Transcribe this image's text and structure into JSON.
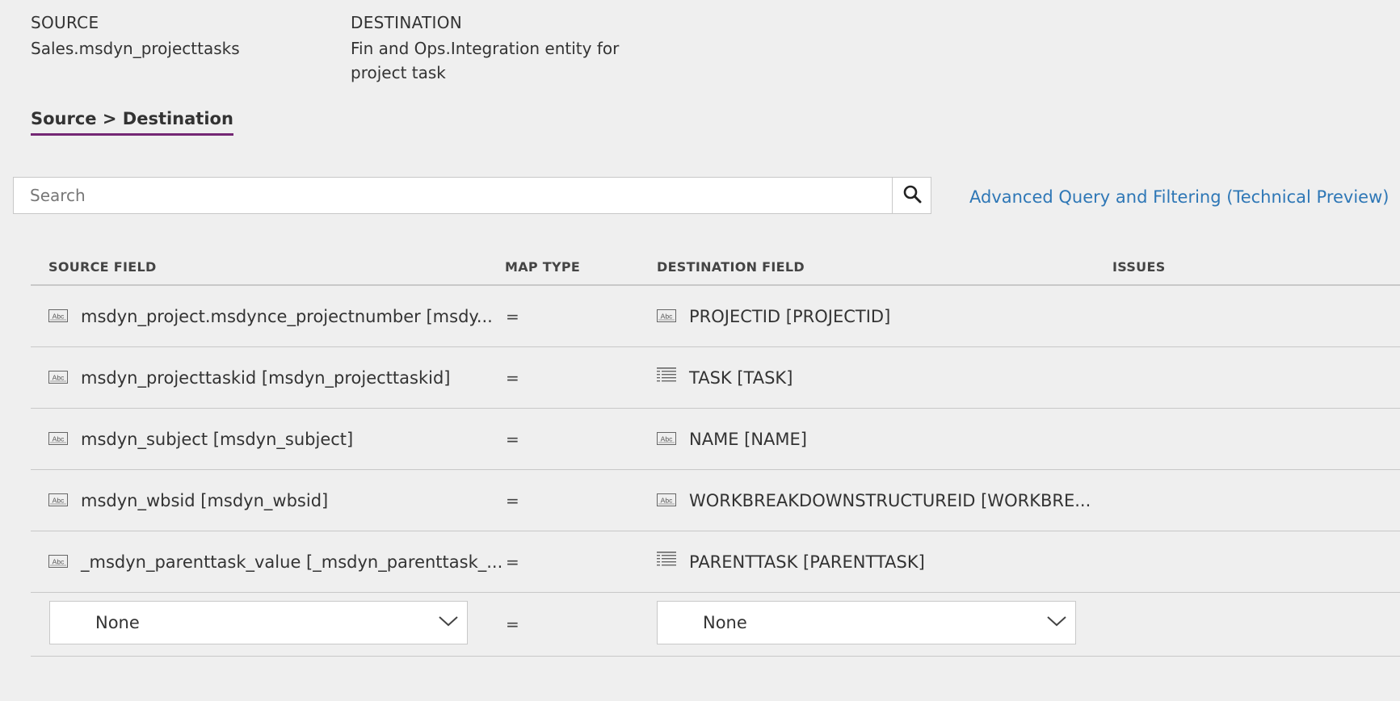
{
  "header": {
    "source_label": "SOURCE",
    "source_value": "Sales.msdyn_projecttasks",
    "destination_label": "DESTINATION",
    "destination_value_line1": "Fin and Ops.Integration entity for",
    "destination_value_line2": "project task"
  },
  "tab": {
    "label": "Source > Destination",
    "accent": "#742774"
  },
  "search": {
    "placeholder": "Search",
    "value": ""
  },
  "advanced_link": {
    "label": "Advanced Query and Filtering (Technical Preview)",
    "color": "#2e77b6"
  },
  "columns": {
    "source": "SOURCE FIELD",
    "map_type": "MAP TYPE",
    "destination": "DESTINATION FIELD",
    "issues": "ISSUES"
  },
  "rows": [
    {
      "source": "msdyn_project.msdynce_projectnumber [msdy...",
      "source_icon": "text-field-icon",
      "map": "=",
      "destination": "PROJECTID [PROJECTID]",
      "destination_icon": "text-field-icon"
    },
    {
      "source": "msdyn_projecttaskid [msdyn_projecttaskid]",
      "source_icon": "text-field-icon",
      "map": "=",
      "destination": "TASK [TASK]",
      "destination_icon": "list-field-icon"
    },
    {
      "source": "msdyn_subject [msdyn_subject]",
      "source_icon": "text-field-icon",
      "map": "=",
      "destination": "NAME [NAME]",
      "destination_icon": "text-field-icon"
    },
    {
      "source": "msdyn_wbsid [msdyn_wbsid]",
      "source_icon": "text-field-icon",
      "map": "=",
      "destination": "WORKBREAKDOWNSTRUCTUREID [WORKBRE...",
      "destination_icon": "text-field-icon"
    },
    {
      "source": "_msdyn_parenttask_value [_msdyn_parenttask_...",
      "source_icon": "text-field-icon",
      "map": "=",
      "destination": "PARENTTASK [PARENTTASK]",
      "destination_icon": "list-field-icon"
    }
  ],
  "new_row": {
    "source_value": "None",
    "map": "=",
    "destination_value": "None"
  }
}
